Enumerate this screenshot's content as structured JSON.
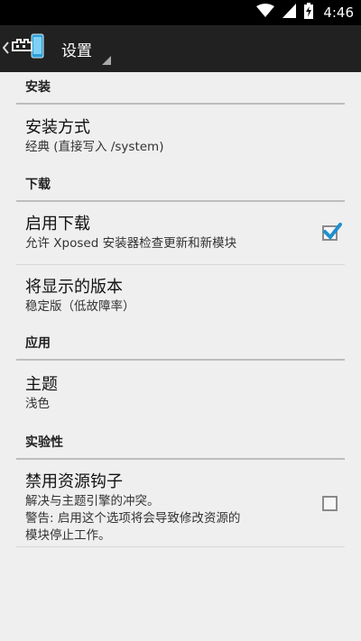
{
  "status_bar": {
    "time": "4:46",
    "icons": [
      "wifi-icon",
      "cellular-signal-icon",
      "battery-charging-icon"
    ]
  },
  "action_bar": {
    "title": "设置",
    "icons": [
      "back-caret-icon",
      "xposed-app-logo"
    ]
  },
  "categories": {
    "install": "安装",
    "download": "下载",
    "apps": "应用",
    "experimental": "实验性"
  },
  "prefs": {
    "install_method": {
      "title": "安装方式",
      "summary": "经典 (直接写入 /system)"
    },
    "enable_downloads": {
      "title": "启用下载",
      "summary": "允许 Xposed 安装器检查更新和新模块",
      "checked": true
    },
    "versions_shown": {
      "title": "将显示的版本",
      "summary": "稳定版（低故障率）"
    },
    "theme": {
      "title": "主题",
      "summary": "浅色"
    },
    "disable_resources": {
      "title": "禁用资源钩子",
      "summary": "解决与主题引擎的冲突。\n警告: 启用这个选项将会导致修改资源的\n模块停止工作。",
      "checked": false
    }
  },
  "colors": {
    "action_bar": "#212121",
    "status_bar": "#000000",
    "background": "#efefef",
    "accent_check": "#1e8fce"
  }
}
